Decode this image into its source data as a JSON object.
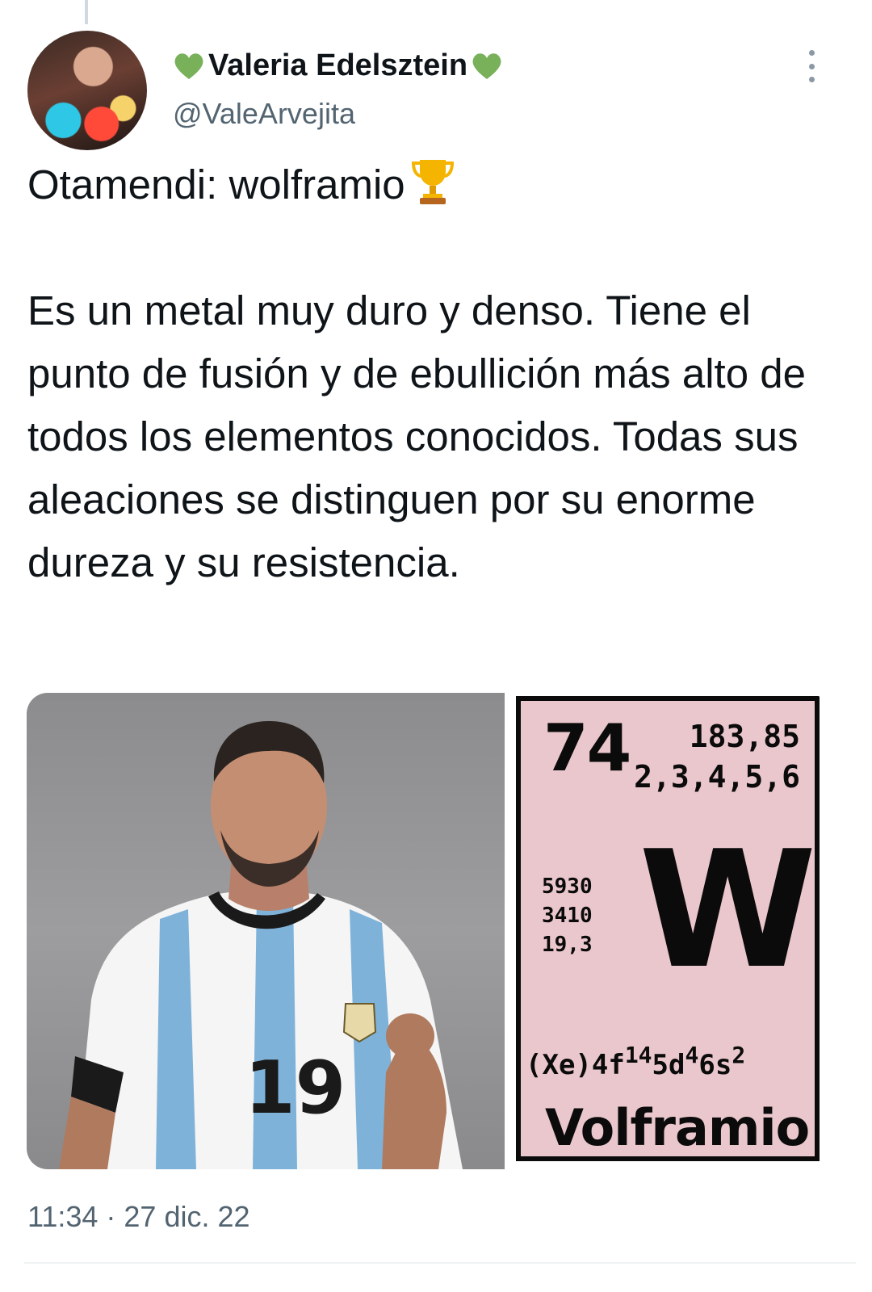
{
  "tweet": {
    "display_name": "Valeria Edelsztein",
    "handle": "@ValeArvejita",
    "avatar_icon": "profile-avatar",
    "name_emoji": "green-heart-icon",
    "title_line": "Otamendi: wolframio",
    "title_emoji": "trophy-icon",
    "body": "Es un metal muy duro y denso. Tiene el punto de fusión y de ebullición más alto de todos los elementos conocidos. Todas sus aleaciones se distinguen por su enorme dureza y su resistencia.",
    "timestamp": "11:34 · 27 dic. 22"
  },
  "element_card": {
    "atomic_number": "74",
    "atomic_mass": "183,85",
    "oxidation_states": "2,3,4,5,6",
    "boiling_point": "5930",
    "melting_point": "3410",
    "density": "19,3",
    "symbol": "W",
    "config_prefix": "(Xe)4f",
    "config_sup1": "14",
    "config_mid1": "5d",
    "config_sup2": "4",
    "config_mid2": "6s",
    "config_sup3": "2",
    "name": "Volframio"
  },
  "photo": {
    "jersey_number": "19"
  },
  "colors": {
    "text_primary": "#0f1419",
    "text_secondary": "#536471",
    "card_pink": "#eac7cc",
    "heart_green": "#78b159"
  }
}
